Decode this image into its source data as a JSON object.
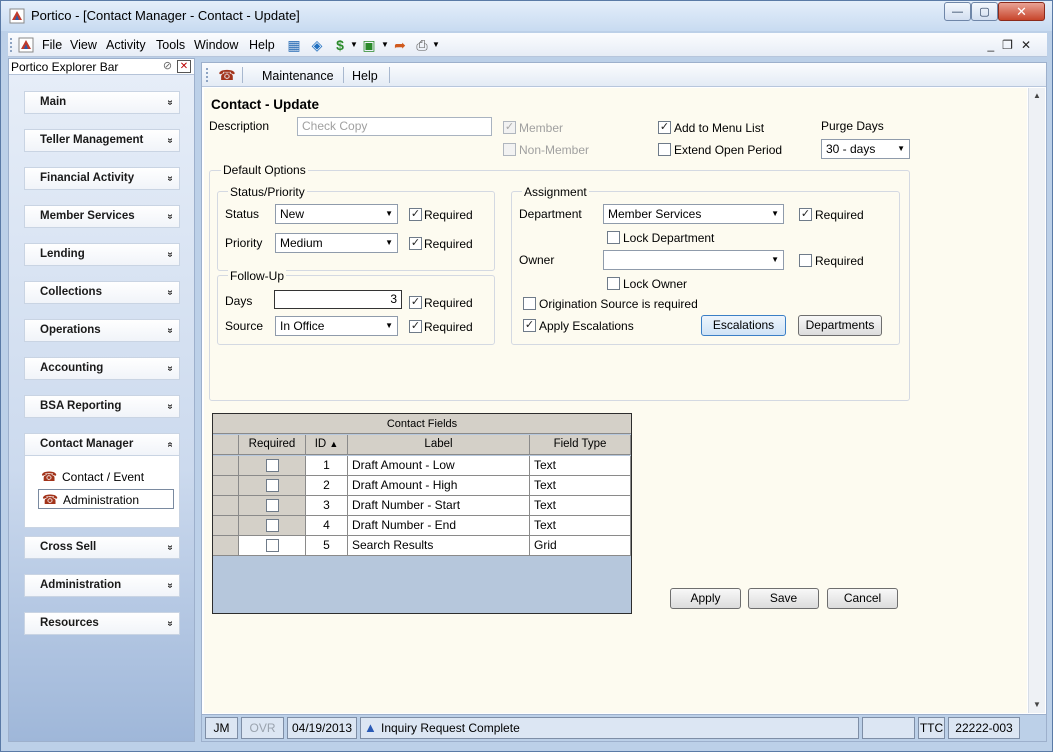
{
  "window": {
    "title": "Portico - [Contact Manager - Contact - Update]",
    "min_glyph": "—",
    "max_glyph": "▢",
    "close_glyph": "✕"
  },
  "menubar": {
    "items": [
      "File",
      "View",
      "Activity",
      "Tools",
      "Window",
      "Help"
    ],
    "mdi_min": "_",
    "mdi_restore": "❐",
    "mdi_close": "✕"
  },
  "explorer": {
    "title": "Portico Explorer Bar",
    "chevron_down": "»",
    "chevron_up": "«",
    "items": [
      {
        "label": "Main",
        "expanded": false
      },
      {
        "label": "Teller Management",
        "expanded": false
      },
      {
        "label": "Financial Activity",
        "expanded": false
      },
      {
        "label": "Member Services",
        "expanded": false
      },
      {
        "label": "Lending",
        "expanded": false
      },
      {
        "label": "Collections",
        "expanded": false
      },
      {
        "label": "Operations",
        "expanded": false
      },
      {
        "label": "Accounting",
        "expanded": false
      },
      {
        "label": "BSA Reporting",
        "expanded": false
      },
      {
        "label": "Contact Manager",
        "expanded": true
      },
      {
        "label": "Cross Sell",
        "expanded": false
      },
      {
        "label": "Administration",
        "expanded": false
      },
      {
        "label": "Resources",
        "expanded": false
      }
    ],
    "contact_manager_subitems": [
      {
        "label": "Contact / Event",
        "selected": false
      },
      {
        "label": "Administration",
        "selected": true
      }
    ]
  },
  "subtoolbar": {
    "maintenance": "Maintenance",
    "help": "Help"
  },
  "form": {
    "title": "Contact - Update",
    "description_label": "Description",
    "description_value": "Check Copy",
    "member_label": "Member",
    "member_checked": true,
    "non_member_label": "Non-Member",
    "non_member_checked": false,
    "add_to_menu_label": "Add to Menu List",
    "add_to_menu_checked": true,
    "extend_open_label": "Extend Open Period",
    "extend_open_checked": false,
    "purge_days_label": "Purge Days",
    "purge_days_value": "30 - days",
    "default_options_title": "Default Options",
    "status_priority": {
      "title": "Status/Priority",
      "status_label": "Status",
      "status_value": "New",
      "status_required": true,
      "priority_label": "Priority",
      "priority_value": "Medium",
      "priority_required": true,
      "required_label": "Required"
    },
    "follow_up": {
      "title": "Follow-Up",
      "days_label": "Days",
      "days_value": "3",
      "days_required": true,
      "source_label": "Source",
      "source_value": "In Office",
      "source_required": true,
      "required_label": "Required"
    },
    "assignment": {
      "title": "Assignment",
      "department_label": "Department",
      "department_value": "Member Services",
      "department_required": true,
      "lock_department_label": "Lock Department",
      "lock_department_checked": false,
      "owner_label": "Owner",
      "owner_value": "",
      "owner_required": false,
      "lock_owner_label": "Lock Owner",
      "lock_owner_checked": false,
      "origination_label": "Origination Source is required",
      "origination_checked": false,
      "apply_escalations_label": "Apply Escalations",
      "apply_escalations_checked": true,
      "required_label": "Required",
      "escalations_button": "Escalations",
      "departments_button": "Departments"
    }
  },
  "contact_fields": {
    "caption": "Contact Fields",
    "columns": [
      "Required",
      "ID",
      "Label",
      "Field Type"
    ],
    "sort_indicator": "▲",
    "rows": [
      {
        "required": false,
        "id": "1",
        "label": "Draft Amount - Low",
        "type": "Text"
      },
      {
        "required": false,
        "id": "2",
        "label": "Draft Amount - High",
        "type": "Text"
      },
      {
        "required": false,
        "id": "3",
        "label": "Draft Number - Start",
        "type": "Text"
      },
      {
        "required": false,
        "id": "4",
        "label": "Draft Number - End",
        "type": "Text"
      },
      {
        "required": false,
        "id": "5",
        "label": "Search Results",
        "type": "Grid"
      }
    ]
  },
  "actions": {
    "apply": "Apply",
    "save": "Save",
    "cancel": "Cancel"
  },
  "statusbar": {
    "user": "JM",
    "ovr": "OVR",
    "date": "04/19/2013",
    "message": "Inquiry Request Complete",
    "ttc": "TTC",
    "account": "22222-003"
  }
}
